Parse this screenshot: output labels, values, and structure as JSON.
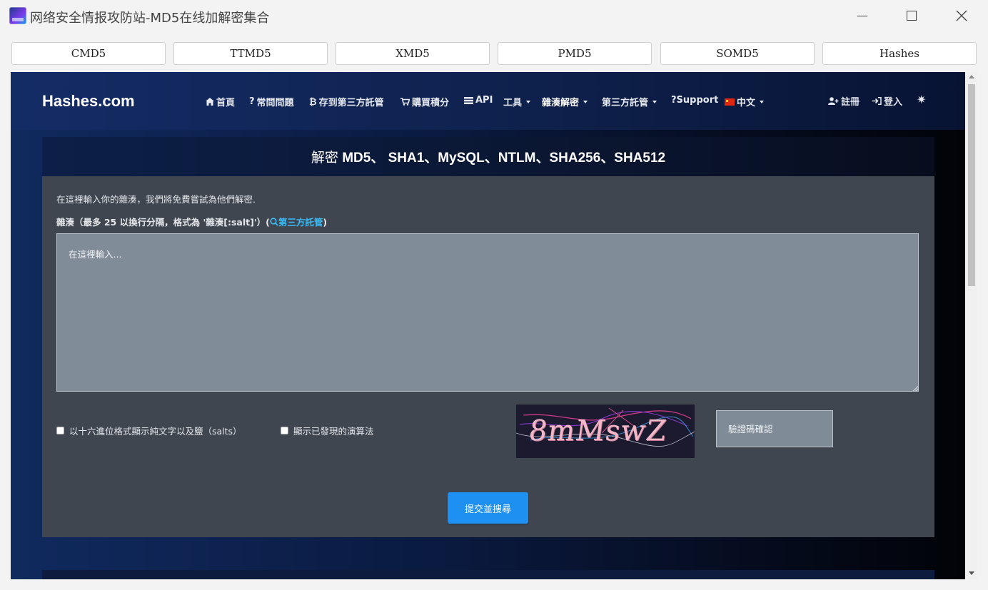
{
  "window": {
    "title": "网络安全情报攻防站-MD5在线加解密集合"
  },
  "tabs": [
    "CMD5",
    "TTMD5",
    "XMD5",
    "PMD5",
    "SOMD5",
    "Hashes"
  ],
  "navbar": {
    "brand": "Hashes.com",
    "items": [
      {
        "icon": "home-icon",
        "label": "首頁"
      },
      {
        "icon": "question-icon",
        "label": "常問問題"
      },
      {
        "icon": "bitcoin-icon",
        "label": "存到第三方託管"
      },
      {
        "icon": "cart-icon",
        "label": "購買積分"
      },
      {
        "icon": "api-icon",
        "label": "API"
      },
      {
        "label": "工具"
      },
      {
        "label": "雜湊解密"
      },
      {
        "label": "第三方託管"
      },
      {
        "label": "?Support"
      },
      {
        "icon": "china-flag-icon",
        "label": "中文"
      }
    ],
    "register": "註冊",
    "login": "登入",
    "theme_icon": "sun-icon"
  },
  "panel": {
    "title_lead": "解密",
    "title_rest": "MD5、 SHA1、MySQL、NTLM、SHA256、SHA512",
    "intro": "在這裡輸入你的雜湊，我們將免費嘗試為他們解密.",
    "label_text": "雜湊（最多 25 以換行分隔，格式為 '雜湊[:salt]'）(",
    "label_link": "第三方託管",
    "label_close": ")",
    "textarea_placeholder": "在這裡輸入...",
    "checkbox_hex": "以十六進位格式顯示純文字以及鹽（salts）",
    "checkbox_algo": "顯示已發現的演算法",
    "captcha_text": "8mMswZ",
    "captcha_placeholder": "驗證碼確認",
    "submit": "提交並搜尋"
  }
}
